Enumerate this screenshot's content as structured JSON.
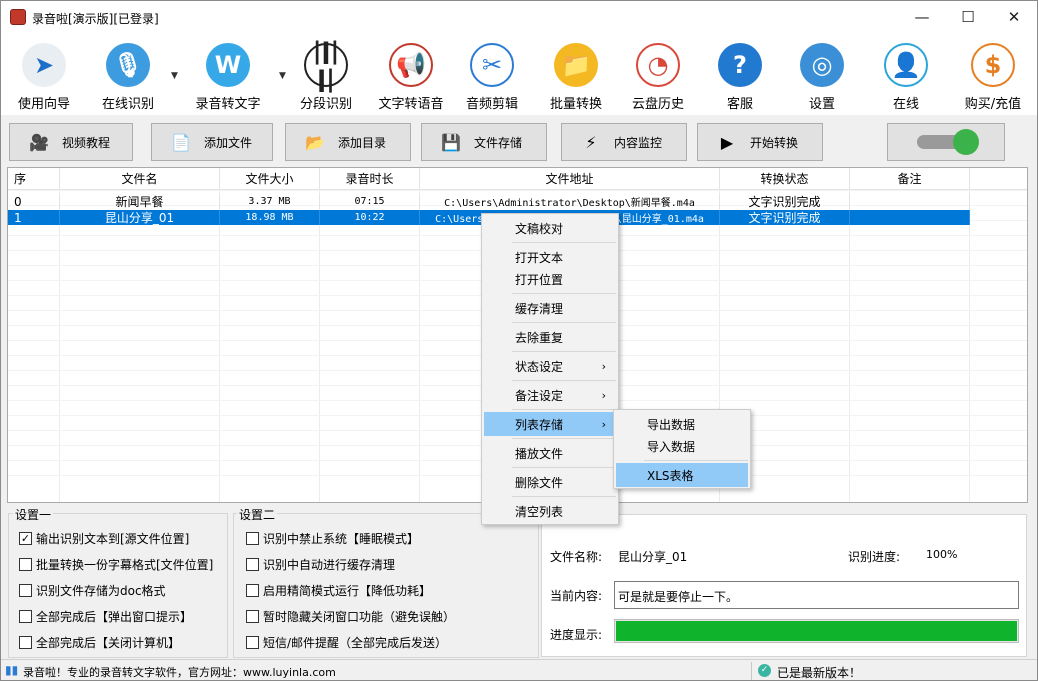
{
  "window": {
    "title": "录音啦[演示版][已登录]",
    "minimize": "—",
    "maximize": "☐",
    "close": "✕"
  },
  "toolbar": [
    {
      "id": "guide",
      "label": "使用向导",
      "icon": "navigation-arrow-icon",
      "glyph": "➤",
      "color": "#e9eef3",
      "fg": "#1c6fc8"
    },
    {
      "id": "online-recognize",
      "label": "在线识别",
      "icon": "microphone-icon",
      "glyph": "🎙",
      "color": "#3d9be0",
      "fg": "#fff"
    },
    {
      "id": "audio-to-text",
      "label": "录音转文字",
      "icon": "w-logo-icon",
      "glyph": "W",
      "color": "#36a8e8",
      "fg": "#fff"
    },
    {
      "id": "segment-recognize",
      "label": "分段识别",
      "icon": "waveform-icon",
      "glyph": "|ǀ|ǀ|",
      "color": "#fff",
      "fg": "#222"
    },
    {
      "id": "text-to-speech",
      "label": "文字转语音",
      "icon": "megaphone-icon",
      "glyph": "📢",
      "color": "#fff",
      "fg": "#c0392b"
    },
    {
      "id": "audio-cut",
      "label": "音频剪辑",
      "icon": "scissors-icon",
      "glyph": "✂",
      "color": "#fff",
      "fg": "#2a7bd4"
    },
    {
      "id": "batch-convert",
      "label": "批量转换",
      "icon": "folder-arrow-icon",
      "glyph": "📁",
      "color": "#f4b822",
      "fg": "#fff"
    },
    {
      "id": "cloud-history",
      "label": "云盘历史",
      "icon": "history-clock-icon",
      "glyph": "◔",
      "color": "#fff",
      "fg": "#d8473a"
    },
    {
      "id": "support",
      "label": "客服",
      "icon": "help-question-icon",
      "glyph": "?",
      "color": "#2279d0",
      "fg": "#fff"
    },
    {
      "id": "settings",
      "label": "设置",
      "icon": "lifebuoy-icon",
      "glyph": "◎",
      "color": "#3a8fd6",
      "fg": "#fff"
    },
    {
      "id": "online",
      "label": "在线",
      "icon": "user-outline-icon",
      "glyph": "👤",
      "color": "#fff",
      "fg": "#2aa6d8"
    },
    {
      "id": "buy",
      "label": "购买/充值",
      "icon": "dollar-coin-icon",
      "glyph": "$",
      "color": "#fff",
      "fg": "#e67e22"
    }
  ],
  "actions": [
    {
      "id": "video-tutorial",
      "label": "视频教程",
      "icon": "camera-people-icon",
      "glyph": "🎥"
    },
    {
      "id": "add-file",
      "label": "添加文件",
      "icon": "add-file-icon",
      "glyph": "📄"
    },
    {
      "id": "add-folder",
      "label": "添加目录",
      "icon": "folder-icon",
      "glyph": "📂"
    },
    {
      "id": "file-save",
      "label": "文件存储",
      "icon": "floppy-disk-icon",
      "glyph": "💾"
    },
    {
      "id": "content-monitor",
      "label": "内容监控",
      "icon": "lightning-icon",
      "glyph": "⚡"
    },
    {
      "id": "start-convert",
      "label": "开始转换",
      "icon": "play-icon",
      "glyph": "▶"
    }
  ],
  "table": {
    "headers": [
      "序",
      "文件名",
      "文件大小",
      "录音时长",
      "文件地址",
      "转换状态",
      "备注"
    ],
    "rows": [
      [
        "0",
        "新闻早餐",
        "3.37 MB",
        "07:15",
        "C:\\Users\\Administrator\\Desktop\\新闻早餐.m4a",
        "文字识别完成",
        ""
      ],
      [
        "1",
        "昆山分享_01",
        "18.98 MB",
        "10:22",
        "C:\\Users\\Administrator\\Desktop\\昆山分享_01.m4a",
        "文字识别完成",
        ""
      ]
    ]
  },
  "context_menu": {
    "items": [
      {
        "label": "文稿校对",
        "sub": false
      },
      {
        "label": "打开文本",
        "sub": false
      },
      {
        "label": "打开位置",
        "sub": false
      },
      {
        "label": "缓存清理",
        "sub": false
      },
      {
        "label": "去除重复",
        "sub": false
      },
      {
        "label": "状态设定",
        "sub": true
      },
      {
        "label": "备注设定",
        "sub": true
      },
      {
        "label": "列表存储",
        "sub": true
      },
      {
        "label": "播放文件",
        "sub": false
      },
      {
        "label": "删除文件",
        "sub": false
      },
      {
        "label": "清空列表",
        "sub": false
      }
    ],
    "highlighted": 7,
    "submenu": {
      "items": [
        "导出数据",
        "导入数据",
        "XLS表格"
      ],
      "highlighted": 2
    }
  },
  "settings1": {
    "title": "设置一",
    "options": [
      {
        "label": "输出识别文本到[源文件位置]",
        "checked": true
      },
      {
        "label": "批量转换一份字幕格式[文件位置]",
        "checked": false
      },
      {
        "label": "识别文件存储为doc格式",
        "checked": false
      },
      {
        "label": "全部完成后【弹出窗口提示】",
        "checked": false
      },
      {
        "label": "全部完成后【关闭计算机】",
        "checked": false
      }
    ]
  },
  "settings2": {
    "title": "设置二",
    "options": [
      {
        "label": "识别中禁止系统【睡眠模式】",
        "checked": false
      },
      {
        "label": "识别中自动进行缓存清理",
        "checked": false
      },
      {
        "label": "启用精简模式运行【降低功耗】",
        "checked": false
      },
      {
        "label": "暂时隐藏关闭窗口功能（避免误触）",
        "checked": false
      },
      {
        "label": "短信/邮件提醒（全部完成后发送）",
        "checked": false
      }
    ]
  },
  "info": {
    "filename_label": "文件名称:",
    "filename": "昆山分享_01",
    "progress_label": "识别进度:",
    "progress_text": "100%",
    "content_label": "当前内容:",
    "content": "可是就是要停止一下。",
    "bar_label": "进度显示:",
    "progress": 1.0,
    "bar_color": "#0fb42c"
  },
  "status": {
    "left": "录音啦！专业的录音转文字软件，官方网址：www.luyinla.com",
    "right": "已是最新版本！"
  }
}
